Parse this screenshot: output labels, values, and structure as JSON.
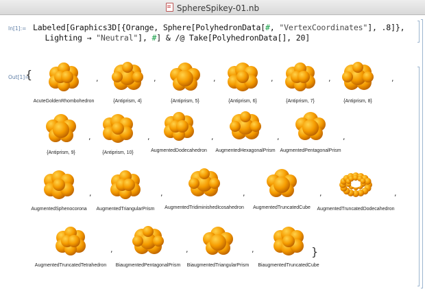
{
  "window": {
    "title": "SphereSpikey-01.nb"
  },
  "input": {
    "label": "In[1]:=",
    "line1": [
      "Labeled[Graphics3D[{Orange, Sphere[PolyhedronData[",
      "#",
      ", ",
      "\"VertexCoordinates\"",
      "], .8]},"
    ],
    "line2": [
      "  Lighting → ",
      "\"Neutral\"",
      "], ",
      "#",
      "] & /@ Take[PolyhedronData[], 20]"
    ]
  },
  "output": {
    "label": "Out[1]=",
    "open_brace": "{",
    "close_brace": "}",
    "separator": ",",
    "items": [
      "AcuteGoldenRhombohedron",
      "{Antiprism, 4}",
      "{Antiprism, 5}",
      "{Antiprism, 6}",
      "{Antiprism, 7}",
      "{Antiprism, 8}",
      "{Antiprism, 9}",
      "{Antiprism, 10}",
      "AugmentedDodecahedron",
      "AugmentedHexagonalPrism",
      "AugmentedPentagonalPrism",
      "AugmentedSphenocorona",
      "AugmentedTriangularPrism",
      "AugmentedTridiminishedIcosahedron",
      "AugmentedTruncatedCube",
      "AugmentedTruncatedDodecahedron",
      "AugmentedTruncatedTetrahedron",
      "BiaugmentedPentagonalPrism",
      "BiaugmentedTriangularPrism",
      "BiaugmentedTruncatedCube"
    ]
  },
  "colors": {
    "sphere": "#f59b00",
    "sphere_highlight": "#ffd24a",
    "sphere_shadow": "#b85f00",
    "label_blue": "#5e7ea6"
  },
  "icons": [
    "notebook-document-icon"
  ]
}
